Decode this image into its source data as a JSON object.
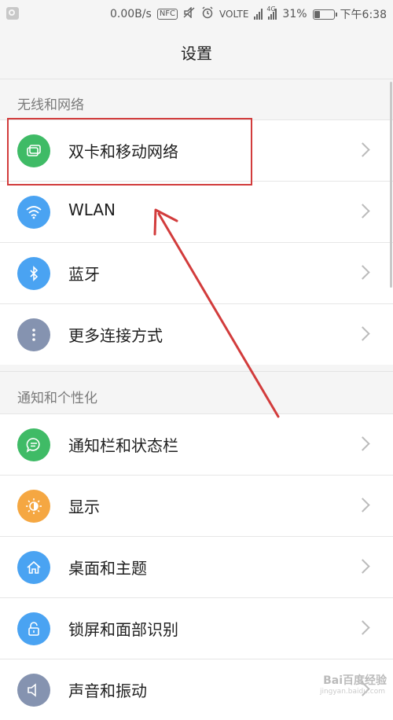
{
  "status_bar": {
    "speed": "0.00B/s",
    "nfc": "NFC",
    "volte": "VOLTE",
    "network": "4G",
    "battery_percent": 31,
    "battery_text": "31%",
    "time": "下午6:38"
  },
  "page_title": "设置",
  "sections": [
    {
      "header": "无线和网络",
      "items": [
        {
          "label": "双卡和移动网络",
          "icon": "sim-card-icon",
          "color": "#3fbb66"
        },
        {
          "label": "WLAN",
          "icon": "wifi-icon",
          "color": "#4aa3f2"
        },
        {
          "label": "蓝牙",
          "icon": "bluetooth-icon",
          "color": "#4aa3f2"
        },
        {
          "label": "更多连接方式",
          "icon": "more-dots-icon",
          "color": "#8593b0"
        }
      ]
    },
    {
      "header": "通知和个性化",
      "items": [
        {
          "label": "通知栏和状态栏",
          "icon": "chat-bubble-icon",
          "color": "#3fbb66"
        },
        {
          "label": "显示",
          "icon": "brightness-icon",
          "color": "#f5a742"
        },
        {
          "label": "桌面和主题",
          "icon": "home-icon",
          "color": "#4aa3f2"
        },
        {
          "label": "锁屏和面部识别",
          "icon": "lock-icon",
          "color": "#4aa3f2"
        },
        {
          "label": "声音和振动",
          "icon": "speaker-icon",
          "color": "#8593b0"
        }
      ]
    }
  ],
  "annotation_color": "#d23c3c",
  "watermark": {
    "brand": "Bai百度经验",
    "url": "jingyan.baidu.com"
  }
}
